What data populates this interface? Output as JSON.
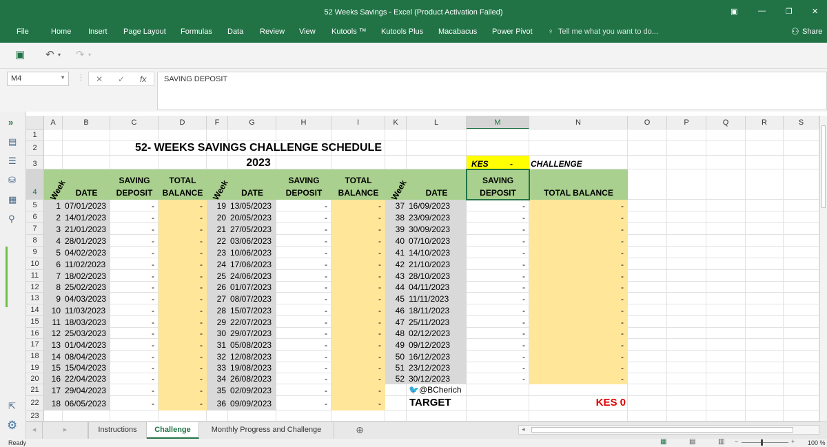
{
  "app": {
    "title": "52 Weeks Savings - Excel (Product Activation Failed)"
  },
  "ribbon": {
    "tabs": [
      "File",
      "Home",
      "Insert",
      "Page Layout",
      "Formulas",
      "Data",
      "Review",
      "View",
      "Kutools ™",
      "Kutools Plus",
      "Macabacus",
      "Power Pivot"
    ],
    "tell_me": "Tell me what you want to do...",
    "share": "Share"
  },
  "formula_bar": {
    "name_box": "M4",
    "content": "SAVING DEPOSIT"
  },
  "columns": [
    "A",
    "B",
    "C",
    "D",
    "F",
    "G",
    "H",
    "I",
    "K",
    "L",
    "M",
    "N",
    "O",
    "P",
    "Q",
    "R",
    "S"
  ],
  "rows": [
    "1",
    "2",
    "3",
    "4",
    "5",
    "6",
    "7",
    "8",
    "9",
    "10",
    "11",
    "12",
    "13",
    "14",
    "15",
    "16",
    "17",
    "18",
    "19",
    "20",
    "21",
    "22",
    "23"
  ],
  "sheet": {
    "title1": "52- WEEKS SAVINGS CHALLENGE SCHEDULE",
    "title2": "2023",
    "kes_label": "KES",
    "kes_dash": "-",
    "challenge_label": "CHALLENGE",
    "hdr_week": "Week",
    "hdr_date": "DATE",
    "hdr_saving": "SAVING",
    "hdr_deposit": "DEPOSIT",
    "hdr_total": "TOTAL",
    "hdr_balance": "BALANCE",
    "hdr_total_balance": "TOTAL BALANCE",
    "dash": "-",
    "credit": "@BCherich",
    "target_label": "TARGET",
    "target_value": "KES 0",
    "block1": [
      [
        "1",
        "07/01/2023"
      ],
      [
        "2",
        "14/01/2023"
      ],
      [
        "3",
        "21/01/2023"
      ],
      [
        "4",
        "28/01/2023"
      ],
      [
        "5",
        "04/02/2023"
      ],
      [
        "6",
        "11/02/2023"
      ],
      [
        "7",
        "18/02/2023"
      ],
      [
        "8",
        "25/02/2023"
      ],
      [
        "9",
        "04/03/2023"
      ],
      [
        "10",
        "11/03/2023"
      ],
      [
        "11",
        "18/03/2023"
      ],
      [
        "12",
        "25/03/2023"
      ],
      [
        "13",
        "01/04/2023"
      ],
      [
        "14",
        "08/04/2023"
      ],
      [
        "15",
        "15/04/2023"
      ],
      [
        "16",
        "22/04/2023"
      ],
      [
        "17",
        "29/04/2023"
      ],
      [
        "18",
        "06/05/2023"
      ]
    ],
    "block2": [
      [
        "19",
        "13/05/2023"
      ],
      [
        "20",
        "20/05/2023"
      ],
      [
        "21",
        "27/05/2023"
      ],
      [
        "22",
        "03/06/2023"
      ],
      [
        "23",
        "10/06/2023"
      ],
      [
        "24",
        "17/06/2023"
      ],
      [
        "25",
        "24/06/2023"
      ],
      [
        "26",
        "01/07/2023"
      ],
      [
        "27",
        "08/07/2023"
      ],
      [
        "28",
        "15/07/2023"
      ],
      [
        "29",
        "22/07/2023"
      ],
      [
        "30",
        "29/07/2023"
      ],
      [
        "31",
        "05/08/2023"
      ],
      [
        "32",
        "12/08/2023"
      ],
      [
        "33",
        "19/08/2023"
      ],
      [
        "34",
        "26/08/2023"
      ],
      [
        "35",
        "02/09/2023"
      ],
      [
        "36",
        "09/09/2023"
      ]
    ],
    "block3": [
      [
        "37",
        "16/09/2023"
      ],
      [
        "38",
        "23/09/2023"
      ],
      [
        "39",
        "30/09/2023"
      ],
      [
        "40",
        "07/10/2023"
      ],
      [
        "41",
        "14/10/2023"
      ],
      [
        "42",
        "21/10/2023"
      ],
      [
        "43",
        "28/10/2023"
      ],
      [
        "44",
        "04/11/2023"
      ],
      [
        "45",
        "11/11/2023"
      ],
      [
        "46",
        "18/11/2023"
      ],
      [
        "47",
        "25/11/2023"
      ],
      [
        "48",
        "02/12/2023"
      ],
      [
        "49",
        "09/12/2023"
      ],
      [
        "50",
        "16/12/2023"
      ],
      [
        "51",
        "23/12/2023"
      ],
      [
        "52",
        "30/12/2023"
      ]
    ]
  },
  "sheet_tabs": [
    "Instructions",
    "Challenge",
    "Monthly Progress and Challenge"
  ],
  "status": {
    "ready": "Ready",
    "zoom": "100 %"
  },
  "colors": {
    "excel_green": "#217346",
    "header_fill": "#a9d08e",
    "balance_fill": "#ffe699",
    "kes_fill": "#ffff00",
    "date_fill": "#d9d9d9",
    "target_red": "#e00000"
  }
}
